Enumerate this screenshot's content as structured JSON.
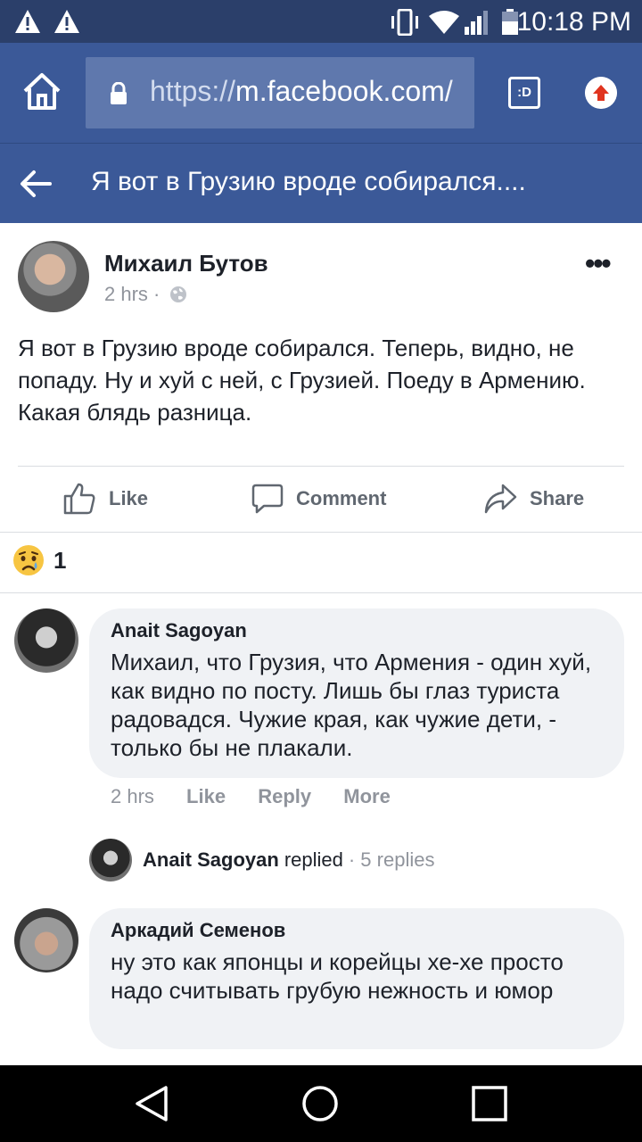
{
  "status_bar": {
    "time": "10:18 PM",
    "icons": [
      "warning-icon",
      "warning-icon",
      "vibrate-icon",
      "wifi-icon",
      "signal-icon",
      "battery-icon"
    ]
  },
  "browser": {
    "url_scheme": "https://",
    "url_host": "m.facebook.com/",
    "tab_label": ":D"
  },
  "header": {
    "title": "Я вот в Грузию вроде собирался...."
  },
  "post": {
    "author": "Михаил Бутов",
    "time": "2 hrs",
    "separator": "·",
    "more": "•••",
    "text": "Я вот в Грузию вроде собирался. Теперь, видно, не попаду. Ну и хуй с ней, с Грузией. Поеду в Армению. Какая блядь разница.",
    "actions": {
      "like": "Like",
      "comment": "Comment",
      "share": "Share"
    },
    "reaction_count": "1"
  },
  "comments": [
    {
      "name": "Anait Sagoyan",
      "text": "Михаил, что Грузия, что Армения - один хуй, как видно по посту. Лишь бы глаз туриста радовадся. Чужие края, как чужие дети, - только бы не плакали.",
      "time": "2 hrs",
      "like": "Like",
      "reply": "Reply",
      "more": "More",
      "replies": {
        "name": "Anait Sagoyan",
        "verb": "replied",
        "count": "· 5 replies"
      }
    },
    {
      "name": "Аркадий Семенов",
      "text": "ну это как японцы и корейцы хе-хе просто надо считывать грубую нежность и юмор"
    }
  ],
  "colors": {
    "facebook_blue": "#3b5998",
    "status_bar": "#2b3f6a",
    "bubble": "#f0f2f5",
    "text": "#1d2129",
    "muted": "#90949c"
  }
}
